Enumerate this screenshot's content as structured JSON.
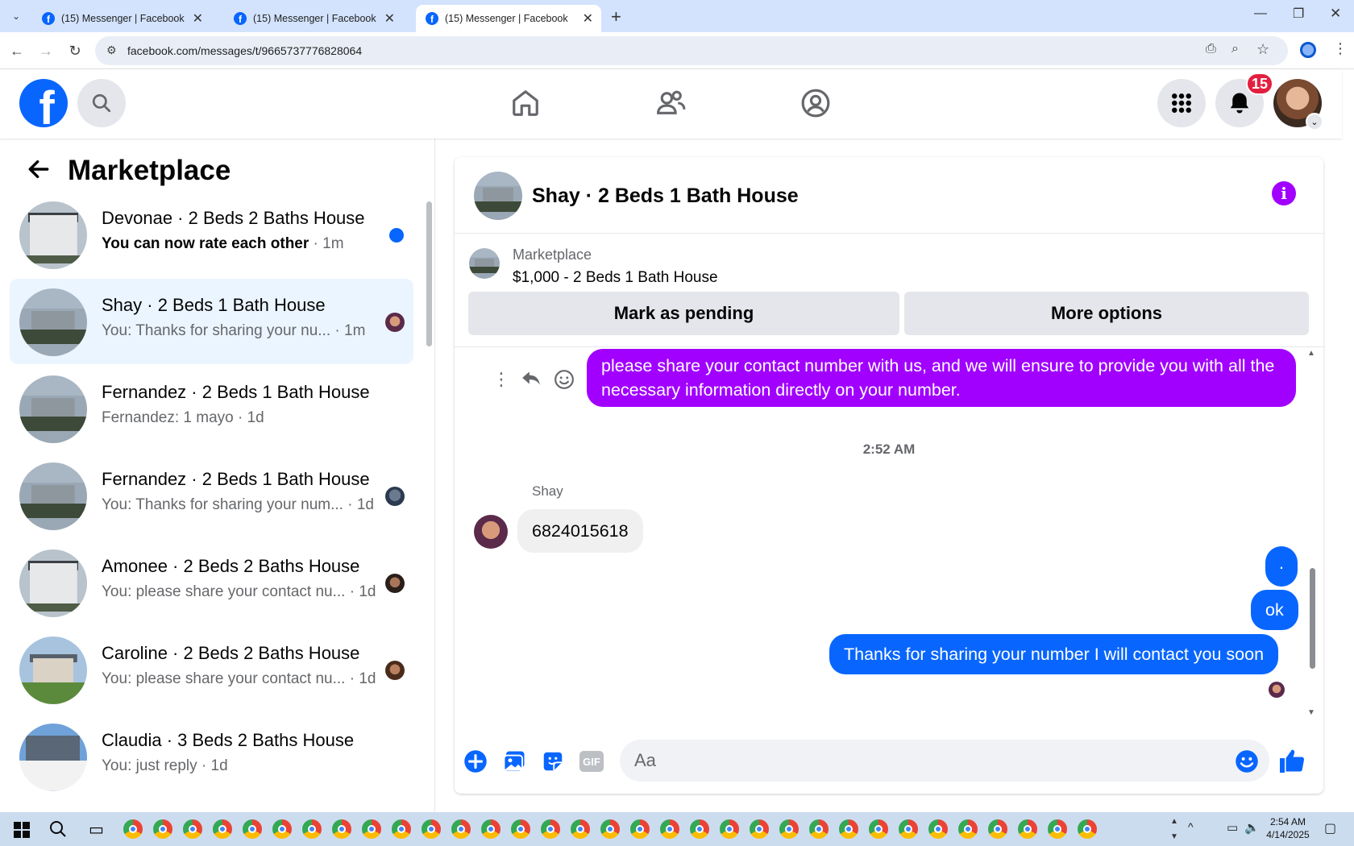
{
  "browser": {
    "tabs": [
      {
        "title": "(15) Messenger | Facebook",
        "active": false
      },
      {
        "title": "(15) Messenger | Facebook",
        "active": false
      },
      {
        "title": "(15) Messenger | Facebook",
        "active": true
      }
    ],
    "url": "facebook.com/messages/t/9665737776828064"
  },
  "fb": {
    "notifications_count": "15"
  },
  "sidebar": {
    "title": "Marketplace",
    "conversations": [
      {
        "name": "Devonae · 2 Beds 2 Baths House",
        "preview": "You can now rate each other",
        "time": " · 1m",
        "unread": true
      },
      {
        "name": "Shay · 2 Beds 1 Bath House",
        "preview": "You: Thanks for sharing your nu...",
        "time": " · 1m",
        "selected": true
      },
      {
        "name": "Fernandez · 2 Beds 1 Bath House",
        "preview": "Fernandez: 1 mayo",
        "time": " · 1d"
      },
      {
        "name": "Fernandez · 2 Beds 1 Bath House",
        "preview": "You: Thanks for sharing your num...",
        "time": " · 1d"
      },
      {
        "name": "Amonee · 2 Beds 2 Baths House",
        "preview": "You: please share your contact nu...",
        "time": " · 1d"
      },
      {
        "name": "Caroline · 2 Beds 2 Baths House",
        "preview": "You: please share your contact nu...",
        "time": " · 1d"
      },
      {
        "name": "Claudia · 3 Beds 2 Baths House",
        "preview": "You: just reply",
        "time": " · 1d"
      }
    ]
  },
  "chat": {
    "title": "Shay · 2 Beds 1 Bath House",
    "listing": {
      "label": "Marketplace",
      "detail": "$1,000 - 2 Beds 1 Bath House"
    },
    "buttons": {
      "pending": "Mark as pending",
      "more": "More options"
    },
    "messages": {
      "m1": "please share your contact number with us, and we will ensure to provide you with all the necessary information directly on your number.",
      "timestamp": "2:52 AM",
      "sender": "Shay",
      "m2": "6824015618",
      "m3": ".",
      "m4": "ok",
      "m5": "Thanks for sharing your number I will contact you soon"
    },
    "composer": {
      "placeholder": "Aa",
      "gif": "GIF"
    }
  },
  "taskbar": {
    "time": "2:54 AM",
    "date": "4/14/2025"
  },
  "colors": {
    "fb_blue": "#0866ff",
    "purple": "#a100ff",
    "notif_red": "#e41e3f"
  }
}
